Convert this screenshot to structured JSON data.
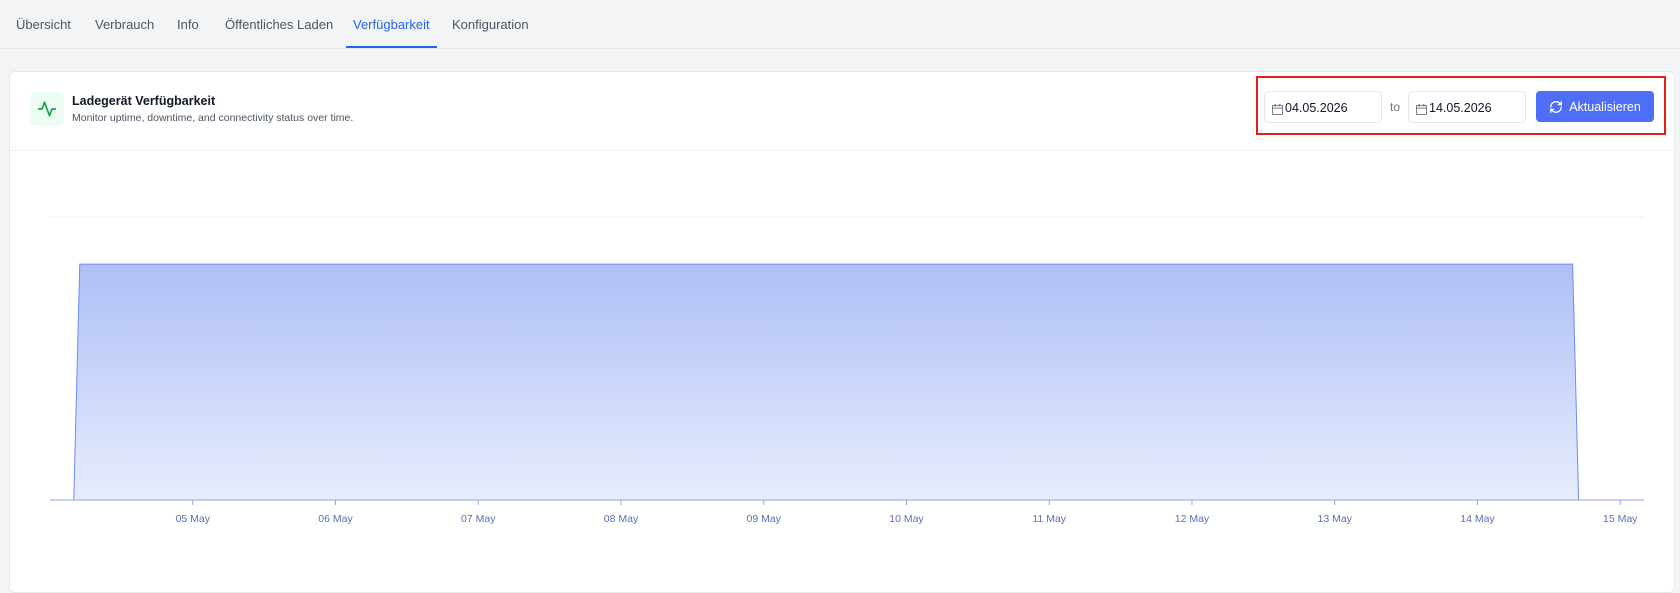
{
  "tabs": [
    {
      "label": "Übersicht",
      "active": false
    },
    {
      "label": "Verbrauch",
      "active": false
    },
    {
      "label": "Info",
      "active": false
    },
    {
      "label": "Öffentliches Laden",
      "active": false
    },
    {
      "label": "Verfügbarkeit",
      "active": true
    },
    {
      "label": "Konfiguration",
      "active": false
    }
  ],
  "card": {
    "icon": "activity-icon",
    "title": "Ladegerät Verfügbarkeit",
    "subtitle": "Monitor uptime, downtime, and connectivity status over time."
  },
  "filters": {
    "from_date": "04.05.2026",
    "to_label": "to",
    "to_date": "14.05.2026",
    "refresh_label": "Aktualisieren",
    "refresh_icon": "refresh-icon",
    "calendar_icon": "calendar-icon"
  },
  "colors": {
    "accent": "#2563eb",
    "button": "#4f6ef7",
    "series_line": "#6b8cf5",
    "highlight": "#e11d1d",
    "icon_green": "#16a34a"
  },
  "chart_data": {
    "type": "area",
    "x_ticks": [
      "05 May",
      "06 May",
      "07 May",
      "08 May",
      "09 May",
      "10 May",
      "11 May",
      "12 May",
      "13 May",
      "14 May",
      "15 May"
    ],
    "series": [
      {
        "x": [
          "2026-05-04T00:00",
          "2026-05-04T04:00",
          "2026-05-04T05:00",
          "2026-05-14T16:00",
          "2026-05-14T17:00",
          "2026-05-15T00:00"
        ],
        "values": [
          0,
          0,
          1,
          1,
          0,
          0
        ]
      }
    ],
    "ylim": [
      0,
      1.2
    ],
    "grid": "horizontal",
    "legend": "none"
  }
}
